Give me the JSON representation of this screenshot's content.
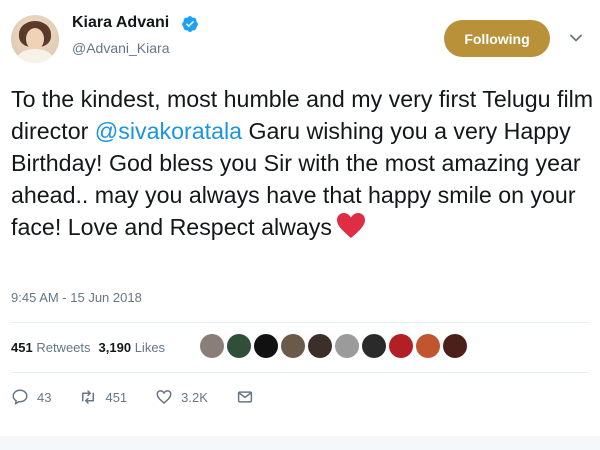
{
  "user": {
    "name": "Kiara Advani",
    "handle": "@Advani_Kiara",
    "verified": true
  },
  "follow_button": {
    "label": "Following",
    "color": "#b89138"
  },
  "tweet": {
    "text_before": "To the kindest, most humble and my very first Telugu film director ",
    "mention": "@sivakoratala",
    "text_after": " Garu wishing you a very Happy Birthday! God bless you Sir with the most amazing year ahead.. may you always have that happy smile on your face! Love and Respect always",
    "emoji": "red-heart",
    "timestamp": "9:45 AM - 15 Jun 2018"
  },
  "stats": {
    "retweets_count": "451",
    "retweets_label": "Retweets",
    "likes_count": "3,190",
    "likes_label": "Likes"
  },
  "likers": [
    {
      "color": "#8a7f78"
    },
    {
      "color": "#2f4f3a"
    },
    {
      "color": "#111111"
    },
    {
      "color": "#6a5a4a"
    },
    {
      "color": "#3c2f2a"
    },
    {
      "color": "#9b9b9b"
    },
    {
      "color": "#2a2a2a"
    },
    {
      "color": "#b21f24"
    },
    {
      "color": "#c0552f"
    },
    {
      "color": "#4b1f1a"
    }
  ],
  "actions": {
    "reply_count": "43",
    "retweet_count": "451",
    "like_count": "3.2K"
  },
  "colors": {
    "mention": "#1b95e0",
    "secondary_text": "#657786",
    "heart": "#e0245e"
  }
}
